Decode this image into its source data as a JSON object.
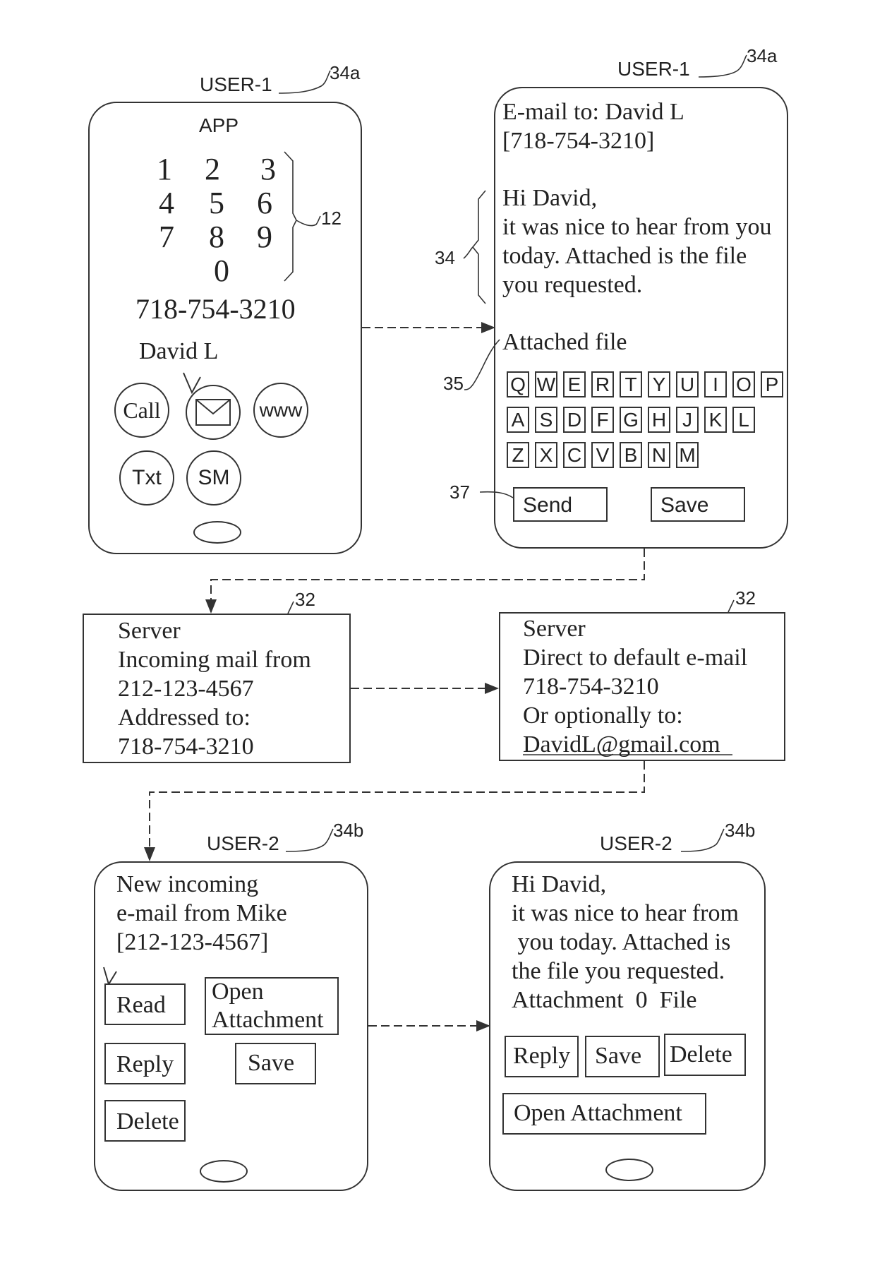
{
  "phone_1": {
    "user_label": "USER-1",
    "ref": "34a",
    "app_title": "APP",
    "keypad": [
      "1",
      "2",
      "3",
      "4",
      "5",
      "6",
      "7",
      "8",
      "9",
      "0"
    ],
    "keypad_ref": "12",
    "phone_number": "718-754-3210",
    "contact_name": "David L",
    "actions": {
      "call": "Call",
      "email_icon": "envelope-icon",
      "www": "www",
      "txt": "Txt",
      "sm": "SM"
    },
    "selected_marker": "check-mark-icon"
  },
  "phone_2": {
    "user_label": "USER-1",
    "ref": "34a",
    "to_line": "E-mail to: David L",
    "to_number": "[718-754-3210]",
    "body_ref": "34",
    "body": [
      "Hi David,",
      "it was nice to hear from you",
      "today. Attached is the file",
      "you requested."
    ],
    "attachment_label": "Attached file",
    "attachment_ref": "35",
    "keyboard_rows": [
      [
        "Q",
        "W",
        "E",
        "R",
        "T",
        "Y",
        "U",
        "I",
        "O",
        "P"
      ],
      [
        "A",
        "S",
        "D",
        "F",
        "G",
        "H",
        "J",
        "K",
        "L"
      ],
      [
        "Z",
        "X",
        "C",
        "V",
        "B",
        "N",
        "M"
      ]
    ],
    "send_ref": "37",
    "send_label": "Send",
    "save_label": "Save"
  },
  "server_1": {
    "ref": "32",
    "lines": [
      "Server",
      "Incoming mail from",
      "212-123-4567",
      "Addressed to:",
      "718-754-3210"
    ]
  },
  "server_2": {
    "ref": "32",
    "lines": [
      "Server",
      "Direct to default e-mail",
      "718-754-3210",
      "Or optionally to:"
    ],
    "email": "DavidL@gmail.com"
  },
  "phone_3": {
    "user_label": "USER-2",
    "ref": "34b",
    "lines": [
      "New incoming",
      "e-mail from Mike",
      "[212-123-4567]"
    ],
    "read_label": "Read",
    "open_attachment_lines": [
      "Open",
      "Attachment"
    ],
    "reply_label": "Reply",
    "save_label": "Save",
    "delete_label": "Delete"
  },
  "phone_4": {
    "user_label": "USER-2",
    "ref": "34b",
    "lines": [
      "Hi David,",
      "it was nice to hear from",
      " you today. Attached is",
      "the file you requested.",
      "Attachment  0  File"
    ],
    "reply_label": "Reply",
    "save_label": "Save",
    "delete_label": "Delete",
    "open_attachment_label": "Open Attachment"
  }
}
